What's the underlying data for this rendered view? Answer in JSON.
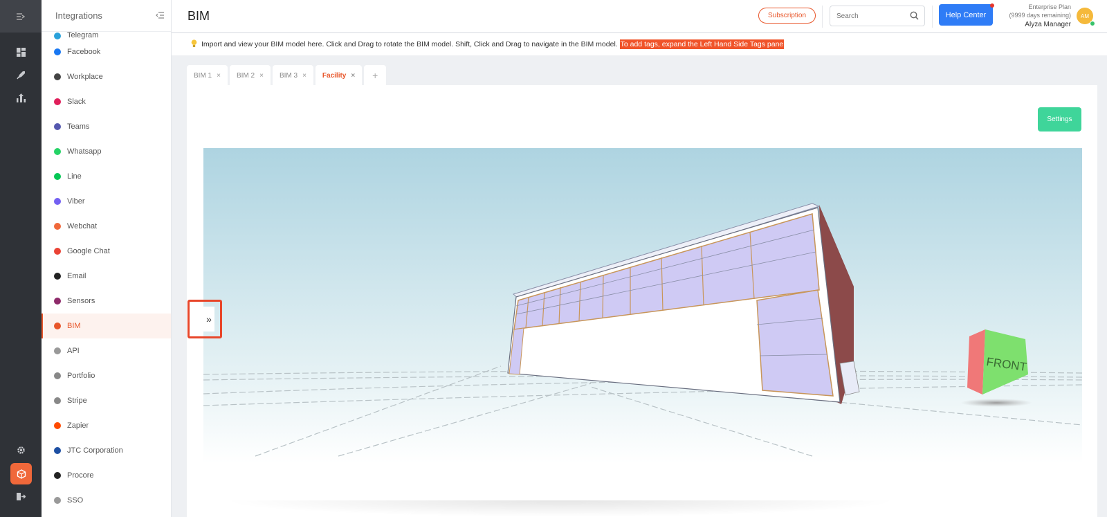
{
  "rail": {
    "icons": [
      "menu-toggle-icon",
      "dashboard-icon",
      "rocket-icon",
      "analytics-icon",
      "settings-icon",
      "bim-cube-icon",
      "logout-icon"
    ]
  },
  "sidebar": {
    "title": "Integrations",
    "partial_item": "Telegram",
    "items": [
      {
        "label": "Facebook",
        "color": "#1877f2"
      },
      {
        "label": "Workplace",
        "color": "#444444"
      },
      {
        "label": "Slack",
        "color": "#e01e5a"
      },
      {
        "label": "Teams",
        "color": "#5558af"
      },
      {
        "label": "Whatsapp",
        "color": "#25d366"
      },
      {
        "label": "Line",
        "color": "#06c755"
      },
      {
        "label": "Viber",
        "color": "#7360f2"
      },
      {
        "label": "Webchat",
        "color": "#f0683a"
      },
      {
        "label": "Google Chat",
        "color": "#ea4335"
      },
      {
        "label": "Email",
        "color": "#222222"
      },
      {
        "label": "Sensors",
        "color": "#8e2a6a"
      },
      {
        "label": "BIM",
        "color": "#e8562a"
      },
      {
        "label": "API",
        "color": "#999999"
      },
      {
        "label": "Portfolio",
        "color": "#888888"
      },
      {
        "label": "Stripe",
        "color": "#888888"
      },
      {
        "label": "Zapier",
        "color": "#ff4a00"
      },
      {
        "label": "JTC Corporation",
        "color": "#1d4fa3"
      },
      {
        "label": "Procore",
        "color": "#222222"
      },
      {
        "label": "SSO",
        "color": "#999999"
      }
    ],
    "active_label": "BIM"
  },
  "header": {
    "title": "BIM",
    "subscription_label": "Subscription",
    "search_placeholder": "Search",
    "help_label": "Help Center",
    "plan_name": "Enterprise Plan",
    "plan_remaining": "(9999 days remaining)",
    "user_name": "Alyza Manager",
    "avatar_initials": "AM"
  },
  "info": {
    "text": "Import and view your BIM model here. Click and Drag to rotate the BIM model. Shift, Click and Drag to navigate in the BIM model.",
    "highlight": "To add tags, expand the Left Hand Side Tags pane"
  },
  "tabs": [
    {
      "label": "BIM 1",
      "active": false
    },
    {
      "label": "BIM 2",
      "active": false
    },
    {
      "label": "BIM 3",
      "active": false
    },
    {
      "label": "Facility",
      "active": true
    }
  ],
  "add_tab_label": "+",
  "settings_label": "Settings",
  "viewer": {
    "cube_label": "FRONT",
    "expand_glyph": "»"
  },
  "colors": {
    "accent": "#e8562a",
    "help": "#2f7cf6",
    "settings": "#3fd59a",
    "rail": "#2f3237"
  }
}
